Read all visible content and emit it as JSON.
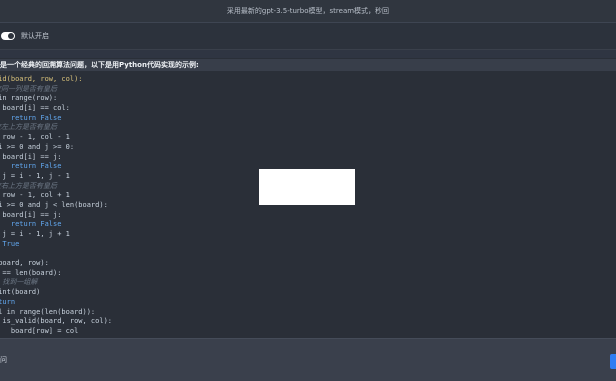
{
  "header": {
    "title": "采用最新的gpt-3.5-turbo模型，stream模式，秒回"
  },
  "settings": {
    "toggle_label": "默认开启"
  },
  "answer": {
    "intro": "是一个经典的回溯算法问题，以下是用Python代码实现的示例:",
    "code_lines": [
      {
        "t": "lid(board, row, col):",
        "c": "fn"
      },
      {
        "t": "查同一列是否有皇后",
        "c": "cm"
      },
      {
        "t": " in range(row):",
        "c": ""
      },
      {
        "t": "f board[i] == col:",
        "c": ""
      },
      {
        "t": "    return False",
        "c": "kw"
      },
      {
        "t": "查左上方是否有皇后",
        "c": "cm"
      },
      {
        "t": "= row - 1, col - 1",
        "c": ""
      },
      {
        "t": " i >= 0 and j >= 0:",
        "c": ""
      },
      {
        "t": "f board[i] == j:",
        "c": ""
      },
      {
        "t": "    return False",
        "c": "kw"
      },
      {
        "t": ", j = i - 1, j - 1",
        "c": ""
      },
      {
        "t": "查右上方是否有皇后",
        "c": "cm"
      },
      {
        "t": "= row - 1, col + 1",
        "c": ""
      },
      {
        "t": " i >= 0 and j < len(board):",
        "c": ""
      },
      {
        "t": "f board[i] == j:",
        "c": ""
      },
      {
        "t": "    return False",
        "c": "kw"
      },
      {
        "t": ", j = i - 1, j + 1",
        "c": ""
      },
      {
        "t": "n True",
        "c": "kw"
      },
      {
        "t": "",
        "c": ""
      },
      {
        "t": "(board, row):",
        "c": ""
      },
      {
        "t": "w == len(board):",
        "c": ""
      },
      {
        "t": "# 找到一组解",
        "c": "cm"
      },
      {
        "t": "rint(board)",
        "c": ""
      },
      {
        "t": "eturn",
        "c": "kw"
      },
      {
        "t": "ol in range(len(board)):",
        "c": ""
      },
      {
        "t": "f is_valid(board, row, col):",
        "c": ""
      },
      {
        "t": "    board[row] = col",
        "c": ""
      }
    ]
  },
  "footer": {
    "input_hint": "问"
  },
  "colors": {
    "accent": "#2f7df2",
    "background": "#2f3542"
  }
}
